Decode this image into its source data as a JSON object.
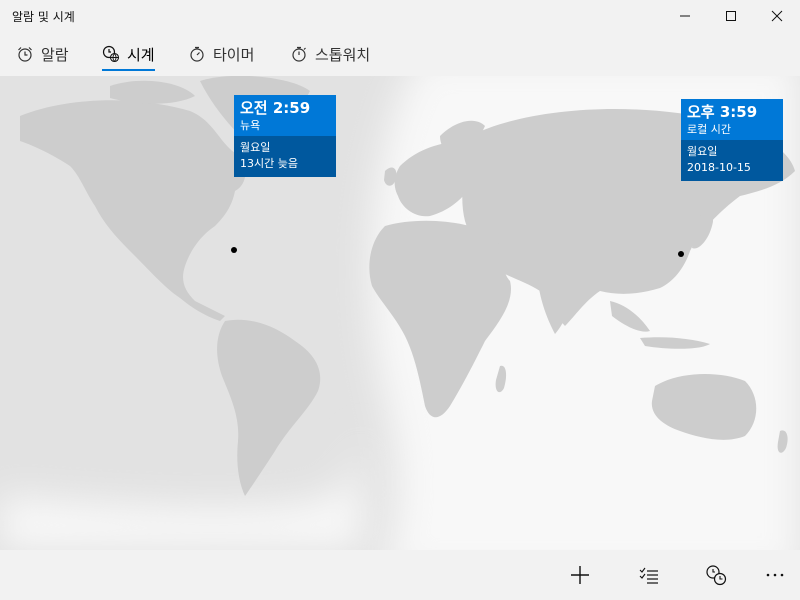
{
  "window": {
    "title": "알람 및 시계"
  },
  "tabs": [
    {
      "label": "알람",
      "icon": "alarm-clock-icon",
      "active": false
    },
    {
      "label": "시계",
      "icon": "world-clock-icon",
      "active": true
    },
    {
      "label": "타이머",
      "icon": "timer-icon",
      "active": false
    },
    {
      "label": "스톱워치",
      "icon": "stopwatch-icon",
      "active": false
    }
  ],
  "clocks": [
    {
      "time": "오전 2:59",
      "place": "뉴욕",
      "day": "월요일",
      "detail": "13시간 늦음"
    },
    {
      "time": "오후 3:59",
      "place": "로컬 시간",
      "day": "월요일",
      "detail": "2018-10-15"
    }
  ],
  "commands": [
    {
      "icon": "add-icon"
    },
    {
      "icon": "select-list-icon"
    },
    {
      "icon": "compare-clock-icon"
    },
    {
      "icon": "more-icon"
    }
  ],
  "colors": {
    "accent": "#0078d7",
    "accent_dark": "#00589e",
    "land": "#cfcfcf",
    "night": "#dcdcdc",
    "day": "#f7f7f7"
  }
}
